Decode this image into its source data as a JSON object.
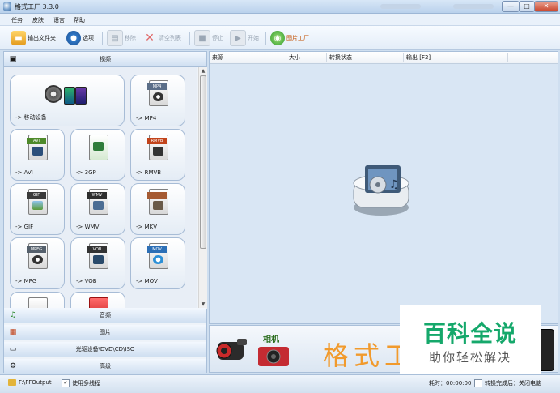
{
  "window": {
    "title": "格式工厂 3.3.0",
    "controls": [
      "—",
      "□",
      "✕"
    ]
  },
  "menu": [
    "任务",
    "皮肤",
    "语言",
    "帮助"
  ],
  "toolbar": {
    "output_folder": "输出文件夹",
    "options": "选项",
    "remove": "移除",
    "clear_list": "清空列表",
    "stop": "停止",
    "start": "开始",
    "image_factory": "图片工厂"
  },
  "left": {
    "video_header": "视频",
    "tiles": [
      {
        "label": "-> 移动设备",
        "badge": ""
      },
      {
        "label": "-> MP4",
        "badge": "MP4",
        "color": "#5b6e88"
      },
      {
        "label": "-> AVI",
        "badge": "AVI",
        "color": "#4e8a2a"
      },
      {
        "label": "-> 3GP",
        "badge": "",
        "color": "#2f7d3a"
      },
      {
        "label": "-> RMVB",
        "badge": "RMVB",
        "color": "#c2431a"
      },
      {
        "label": "-> GIF",
        "badge": "GIF",
        "color": "#3a3a3a"
      },
      {
        "label": "-> WMV",
        "badge": "WMV",
        "color": "#2e2e2e"
      },
      {
        "label": "-> MKV",
        "badge": "",
        "color": "#a55a32"
      },
      {
        "label": "-> MPG",
        "badge": "MPEG",
        "color": "#55606c"
      },
      {
        "label": "-> VOB",
        "badge": "VOB",
        "color": "#333333"
      },
      {
        "label": "-> MOV",
        "badge": "MOV",
        "color": "#2c6fb6"
      }
    ],
    "categories": [
      {
        "label": "音频",
        "icon": "♫"
      },
      {
        "label": "图片",
        "icon": "▦"
      },
      {
        "label": "光驱设备\\DVD\\CD\\ISO",
        "icon": "▭"
      },
      {
        "label": "高级",
        "icon": "⚙"
      }
    ]
  },
  "list": {
    "columns": [
      "来源",
      "大小",
      "转换状态",
      "输出 [F2]"
    ]
  },
  "banner": {
    "camera_label": "相机",
    "text": "格式工"
  },
  "watermark": {
    "line1": "百科全说",
    "line2": "助你轻松解决"
  },
  "status": {
    "output_path": "F:\\FFOutput",
    "multithread": "使用多线程",
    "elapsed": "耗时：00:00:00",
    "after_convert": "转换完成后：关闭电脑"
  }
}
